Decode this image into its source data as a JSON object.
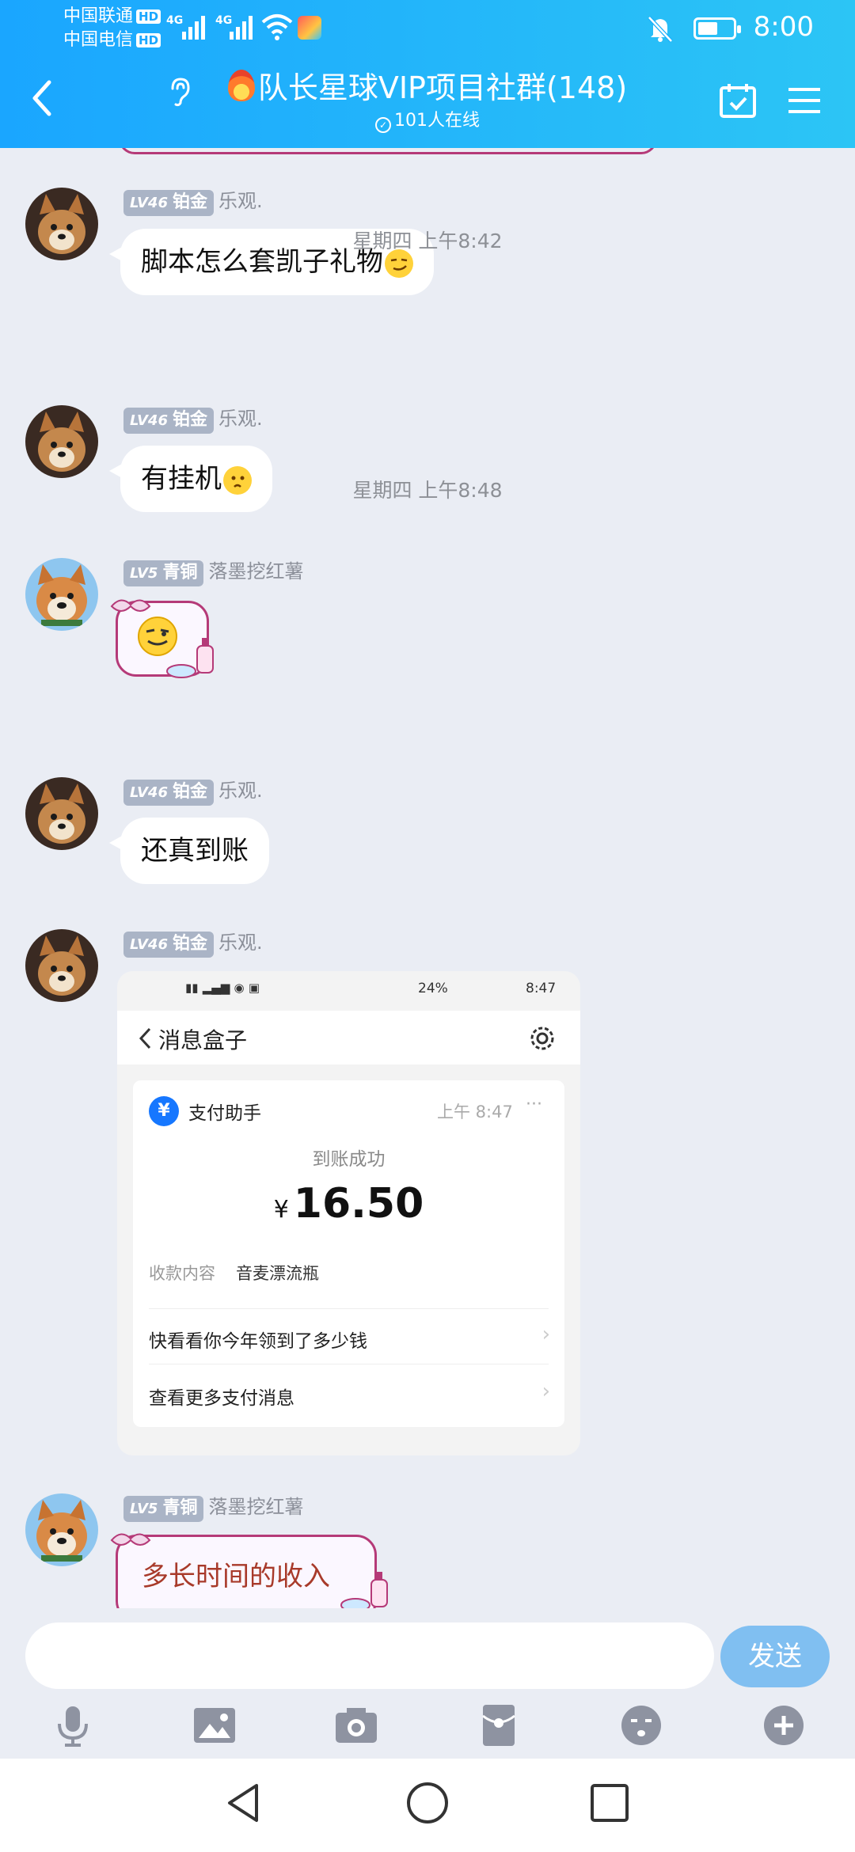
{
  "status_bar": {
    "carrier1": "中国联通",
    "carrier2": "中国电信",
    "hd": "HD",
    "net1": "4G",
    "net2": "4G",
    "time": "8:00"
  },
  "header": {
    "title": "队长星球VIP项目社群(148)",
    "online": "101人在线"
  },
  "messages": [
    {
      "level": "LV46",
      "rank": "铂金",
      "name": "乐观.",
      "text": "脚本怎么套凯子礼物"
    },
    {
      "timestamp": "星期四 上午8:42"
    },
    {
      "level": "LV46",
      "rank": "铂金",
      "name": "乐观.",
      "text": "有挂机"
    },
    {
      "level": "LV5",
      "rank": "青铜",
      "name": "落墨挖红薯"
    },
    {
      "timestamp": "星期四 上午8:48"
    },
    {
      "level": "LV46",
      "rank": "铂金",
      "name": "乐观.",
      "text": "还真到账"
    },
    {
      "level": "LV46",
      "rank": "铂金",
      "name": "乐观."
    },
    {
      "level": "LV5",
      "rank": "青铜",
      "name": "落墨挖红薯",
      "text": "多长时间的收入"
    }
  ],
  "screenshot": {
    "status_right": "24%",
    "time": "8:47",
    "nav_title": "消息盒子",
    "sender": "支付助手",
    "sent_time": "上午 8:47",
    "more": "···",
    "status": "到账成功",
    "currency": "¥",
    "amount": "16.50",
    "content_label": "收款内容",
    "content_value": "音麦漂流瓶",
    "link1": "快看看你今年领到了多少钱",
    "link2": "查看更多支付消息"
  },
  "input": {
    "send_label": "发送"
  },
  "colors": {
    "header": "#1aa6ff",
    "chat_bg": "#eaedf4",
    "send": "#80bff1"
  }
}
